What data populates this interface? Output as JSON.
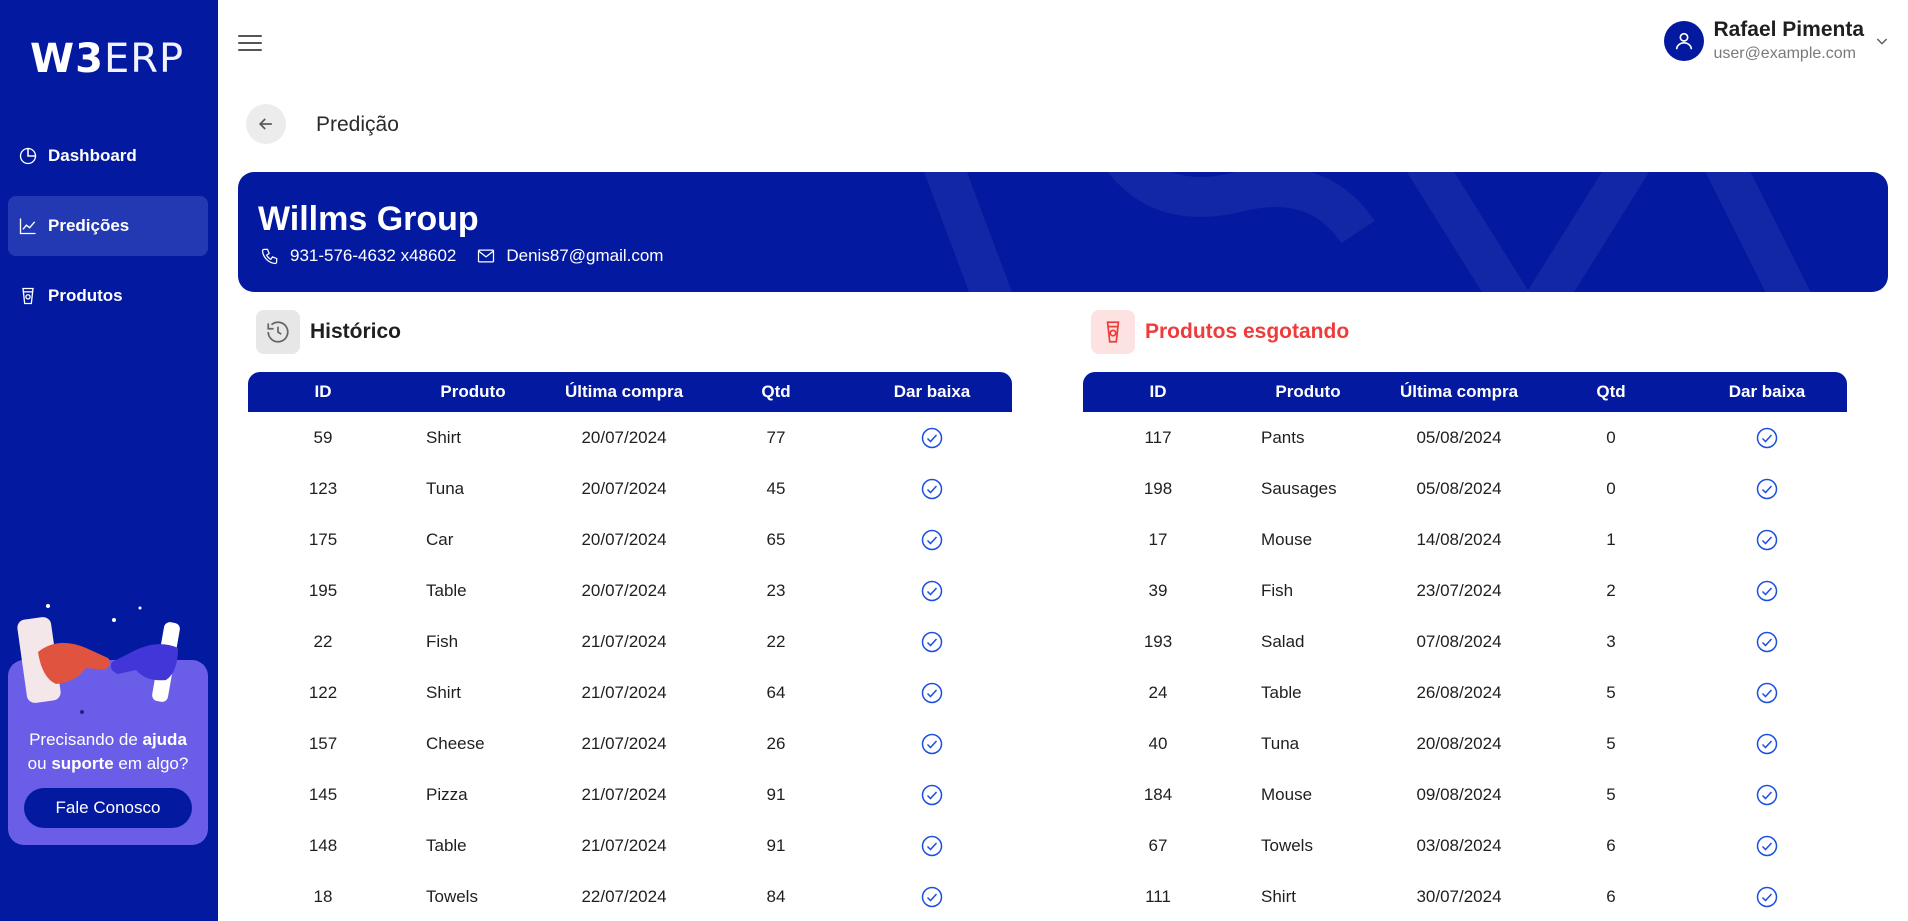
{
  "brand": {
    "logo_bold": "W3",
    "logo_thin": "ERP"
  },
  "sidebar": {
    "items": [
      {
        "label": "Dashboard",
        "icon": "pie-chart-icon",
        "active": false
      },
      {
        "label": "Predições",
        "icon": "line-chart-icon",
        "active": true
      },
      {
        "label": "Produtos",
        "icon": "product-icon",
        "active": false
      }
    ],
    "help": {
      "line1_pre": "Precisando de ",
      "line1_bold": "ajuda",
      "line2_pre": "ou ",
      "line2_bold": "suporte",
      "line2_post": " em algo?",
      "button_label": "Fale Conosco"
    }
  },
  "header": {
    "user_name": "Rafael Pimenta",
    "user_email": "user@example.com",
    "page_title": "Predição"
  },
  "client": {
    "name": "Willms Group",
    "phone": "931-576-4632 x48602",
    "email": "Denis87@gmail.com"
  },
  "colors": {
    "primary": "#031aa0",
    "accent_purple": "#6a5ee8",
    "alert_red": "#ef3b3b",
    "check_blue": "#1c4fe0"
  },
  "historico": {
    "title": "Histórico",
    "columns": [
      "ID",
      "Produto",
      "Última compra",
      "Qtd",
      "Dar baixa"
    ],
    "rows": [
      [
        "59",
        "Shirt",
        "20/07/2024",
        "77"
      ],
      [
        "123",
        "Tuna",
        "20/07/2024",
        "45"
      ],
      [
        "175",
        "Car",
        "20/07/2024",
        "65"
      ],
      [
        "195",
        "Table",
        "20/07/2024",
        "23"
      ],
      [
        "22",
        "Fish",
        "21/07/2024",
        "22"
      ],
      [
        "122",
        "Shirt",
        "21/07/2024",
        "64"
      ],
      [
        "157",
        "Cheese",
        "21/07/2024",
        "26"
      ],
      [
        "145",
        "Pizza",
        "21/07/2024",
        "91"
      ],
      [
        "148",
        "Table",
        "21/07/2024",
        "91"
      ],
      [
        "18",
        "Towels",
        "22/07/2024",
        "84"
      ]
    ]
  },
  "esgotando": {
    "title": "Produtos esgotando",
    "columns": [
      "ID",
      "Produto",
      "Última compra",
      "Qtd",
      "Dar baixa"
    ],
    "rows": [
      [
        "117",
        "Pants",
        "05/08/2024",
        "0"
      ],
      [
        "198",
        "Sausages",
        "05/08/2024",
        "0"
      ],
      [
        "17",
        "Mouse",
        "14/08/2024",
        "1"
      ],
      [
        "39",
        "Fish",
        "23/07/2024",
        "2"
      ],
      [
        "193",
        "Salad",
        "07/08/2024",
        "3"
      ],
      [
        "24",
        "Table",
        "26/08/2024",
        "5"
      ],
      [
        "40",
        "Tuna",
        "20/08/2024",
        "5"
      ],
      [
        "184",
        "Mouse",
        "09/08/2024",
        "5"
      ],
      [
        "67",
        "Towels",
        "03/08/2024",
        "6"
      ],
      [
        "111",
        "Shirt",
        "30/07/2024",
        "6"
      ]
    ]
  }
}
